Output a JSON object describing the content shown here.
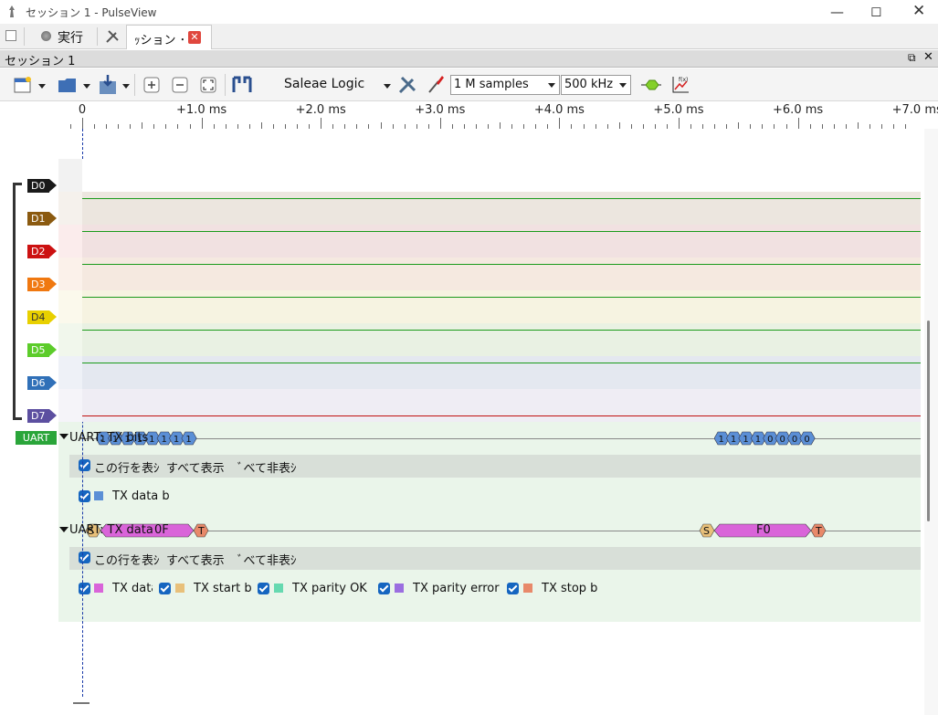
{
  "window": {
    "title": "セッション 1 - PulseView"
  },
  "tabs": {
    "run_label": "実行",
    "session_tab": "ｯション ･"
  },
  "session_bar": {
    "title": "セッション 1"
  },
  "toolbar": {
    "device": "Saleae Logic",
    "samples": "1 M samples",
    "rate": "500 kHz"
  },
  "ruler": {
    "labels": [
      "0",
      "+1.0 ms",
      "+2.0 ms",
      "+3.0 ms",
      "+4.0 ms",
      "+5.0 ms",
      "+6.0 ms",
      "+7.0 ms"
    ]
  },
  "channels": [
    {
      "name": "D0",
      "color": "#1a1a1a"
    },
    {
      "name": "D1",
      "color": "#8b5a10"
    },
    {
      "name": "D2",
      "color": "#cc1111"
    },
    {
      "name": "D3",
      "color": "#f07810"
    },
    {
      "name": "D4",
      "color": "#e8d000"
    },
    {
      "name": "D5",
      "color": "#5ccc2a"
    },
    {
      "name": "D6",
      "color": "#3070b8"
    },
    {
      "name": "D7",
      "color": "#5c4fa0"
    }
  ],
  "decoder1": {
    "tag": "UART",
    "label": "UART: TX bits",
    "bits_left": [
      "1",
      "1",
      "1",
      "1",
      "1",
      "1",
      "1",
      "1"
    ],
    "bits_right": [
      "1",
      "1",
      "1",
      "1",
      "0",
      "0",
      "0",
      "0"
    ],
    "opts_row": {
      "show_this": "この行を表ｼ",
      "show_all": "すべて表示",
      "hide_all": "ﾞべて非表ｼ"
    },
    "classes": [
      {
        "label": "TX data b",
        "color": "#5b8fd6"
      }
    ]
  },
  "decoder2": {
    "label": "UART: TX data",
    "value_left": "0F",
    "start_left": "S",
    "stop_left": "T",
    "value_right": "F0",
    "start_right": "S",
    "stop_right": "T",
    "opts_row": {
      "show_this": "この行を表ｼ",
      "show_all": "すべて表示",
      "hide_all": "ﾞべて非表ｼ"
    },
    "classes": [
      {
        "label": "TX data",
        "color": "#d964d9"
      },
      {
        "label": "TX start b",
        "color": "#e8c07a"
      },
      {
        "label": "TX parity OK",
        "color": "#66d9b0"
      },
      {
        "label": "TX parity error",
        "color": "#9b6ee0"
      },
      {
        "label": "TX stop b",
        "color": "#e8896a"
      }
    ]
  }
}
